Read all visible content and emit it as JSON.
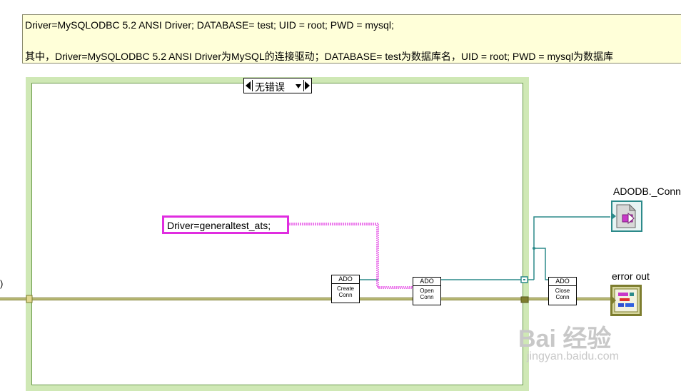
{
  "comment": {
    "line1": "Driver=MySQLODBC 5.2 ANSI Driver; DATABASE= test; UID = root; PWD = mysql;",
    "line2": "其中，Driver=MySQLODBC 5.2 ANSI Driver为MySQL的连接驱动；DATABASE= test为数据库名，UID = root; PWD = mysql为数据库"
  },
  "case_structure": {
    "selector_label": "无错误"
  },
  "string_constant": "Driver=generaltest_ats;",
  "nodes": {
    "create_conn": {
      "header": "ADO",
      "line1": "Create",
      "line2": "Conn"
    },
    "open_conn": {
      "header": "ADO",
      "line1": "Open",
      "line2": "Conn"
    },
    "close_conn": {
      "header": "ADO",
      "line1": "Close",
      "line2": "Conn"
    }
  },
  "indicators": {
    "adodb_label": "ADODB._Conn",
    "error_label": "error out"
  },
  "edge_text": ")",
  "watermark": {
    "brand": "Bai  经验",
    "url": "jingyan.baidu.com"
  },
  "colors": {
    "error_wire": "#7d7d2e",
    "refnum_wire": "#2c8a8a",
    "string_wire": "#e02de0",
    "case_border": "#6a9a4a"
  }
}
